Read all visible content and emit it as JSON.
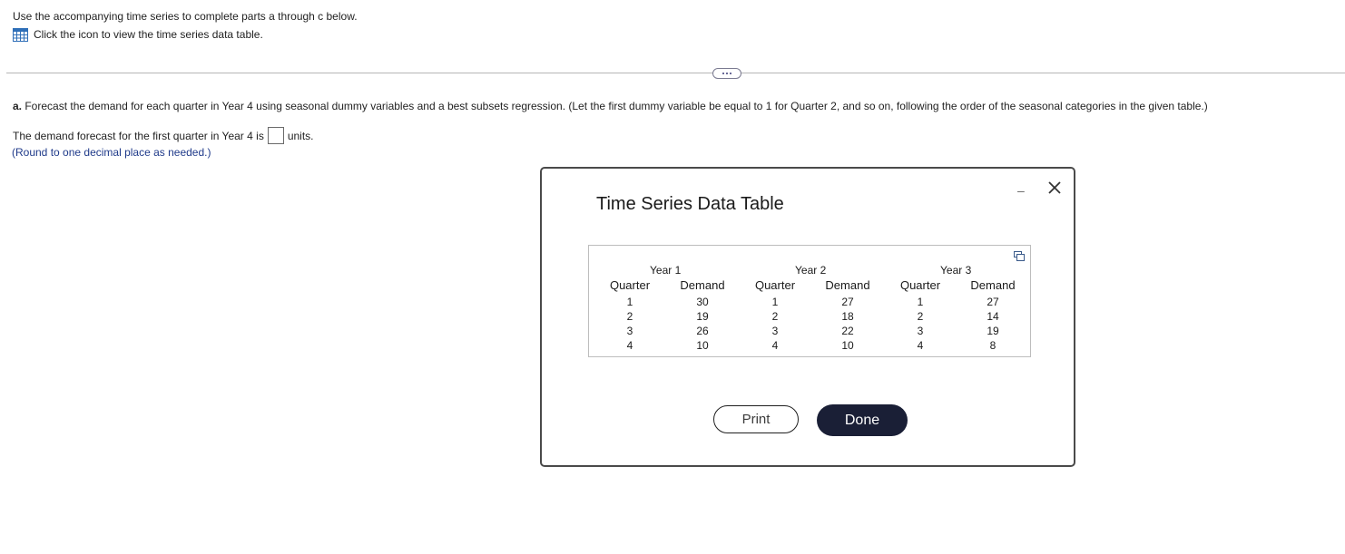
{
  "intro": {
    "instruction": "Use the accompanying time series to complete parts a through c below.",
    "link_text": "Click the icon to view the time series data table.",
    "icon": "table-grid-icon"
  },
  "question": {
    "part_label": "a.",
    "text": " Forecast the demand for each quarter in Year 4 using seasonal dummy variables and a best subsets regression. (Let the first dummy variable be equal to 1 for Quarter 2, and so on, following the order of the seasonal categories in the given table.)",
    "answer_prefix": "The demand forecast for the first quarter in Year 4 is",
    "answer_value": "",
    "answer_suffix": "units.",
    "round_note": "(Round to one decimal place as needed.)"
  },
  "modal": {
    "title": "Time Series Data Table",
    "minimize_label": "–",
    "close_icon": "close-icon",
    "copy_icon": "copy-icon",
    "years": [
      {
        "label": "Year 1",
        "quarter_header": "Quarter",
        "demand_header": "Demand",
        "quarters": [
          "1",
          "2",
          "3",
          "4"
        ],
        "demand": [
          "30",
          "19",
          "26",
          "10"
        ]
      },
      {
        "label": "Year 2",
        "quarter_header": "Quarter",
        "demand_header": "Demand",
        "quarters": [
          "1",
          "2",
          "3",
          "4"
        ],
        "demand": [
          "27",
          "18",
          "22",
          "10"
        ]
      },
      {
        "label": "Year 3",
        "quarter_header": "Quarter",
        "demand_header": "Demand",
        "quarters": [
          "1",
          "2",
          "3",
          "4"
        ],
        "demand": [
          "27",
          "14",
          "19",
          "8"
        ]
      }
    ],
    "print_label": "Print",
    "done_label": "Done"
  },
  "colors": {
    "note_blue": "#1f3a8a",
    "done_bg": "#1a1f36",
    "icon_blue": "#2f6fb8"
  }
}
